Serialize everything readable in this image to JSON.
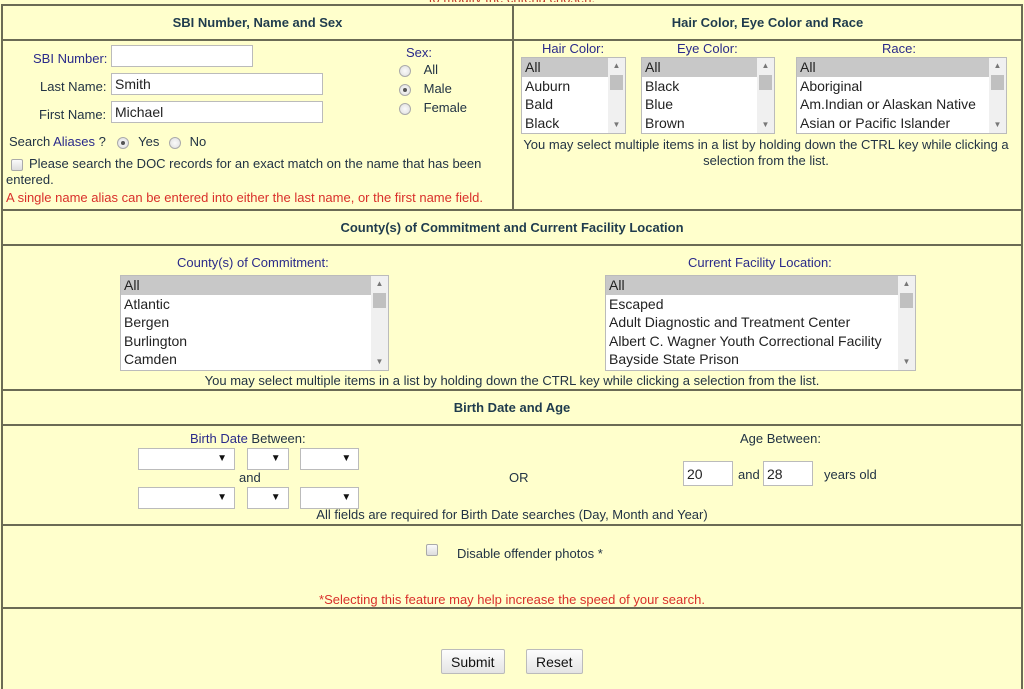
{
  "top_note": "to modify the criteria chosen.",
  "sections": {
    "name_sex": {
      "header": "SBI Number, Name and Sex",
      "sbi_label": "SBI Number:",
      "sbi_value": "",
      "last_name_label": "Last Name:",
      "last_name_value": "Smith",
      "first_name_label": "First Name:",
      "first_name_value": "Michael",
      "sex_label": "Sex:",
      "sex_options": [
        {
          "label": "All",
          "checked": false
        },
        {
          "label": "Male",
          "checked": true
        },
        {
          "label": "Female",
          "checked": false
        }
      ],
      "aliases_prefix": "Search ",
      "aliases_link": "Aliases",
      "aliases_suffix": " ?",
      "aliases_yes": "Yes",
      "aliases_no": "No",
      "exact_match_label": "Please search the DOC records for an exact match on the name that has been entered.",
      "exact_match_checked": false,
      "alias_note": "A single name alias can be entered into either the last name, or the first name field."
    },
    "hair_eye_race": {
      "header": "Hair Color, Eye Color and Race",
      "hair_label": "Hair Color:",
      "hair_options": [
        "All",
        "Auburn",
        "Bald",
        "Black"
      ],
      "eye_label": "Eye Color:",
      "eye_options": [
        "All",
        "Black",
        "Blue",
        "Brown"
      ],
      "race_label": "Race:",
      "race_options": [
        "All",
        "Aboriginal",
        "Am.Indian or Alaskan Native",
        "Asian or Pacific Islander"
      ],
      "note": "You may select multiple items in a list by holding down the CTRL key while clicking a selection from the list."
    },
    "county_facility": {
      "header": "County(s) of Commitment and Current Facility Location",
      "county_label": "County(s) of Commitment:",
      "county_options": [
        "All",
        "Atlantic",
        "Bergen",
        "Burlington",
        "Camden"
      ],
      "facility_label": "Current Facility Location:",
      "facility_options": [
        "All",
        "Escaped",
        "Adult Diagnostic and Treatment Center",
        "Albert C. Wagner Youth Correctional Facility",
        "Bayside State Prison"
      ],
      "note": "You may select multiple items in a list by holding down the CTRL key while clicking a selection from the list."
    },
    "birth_age": {
      "header": "Birth Date and Age",
      "birth_label_link": "Birth Date",
      "birth_label_rest": " Between:",
      "and_label": "and",
      "or_label": "OR",
      "age_label": "Age Between:",
      "age_from": "20",
      "age_and": "and",
      "age_to": "28",
      "age_suffix": "years old",
      "required_note": "All fields are required for Birth Date searches (Day, Month and Year)"
    },
    "photos": {
      "label": "Disable offender photos *",
      "checked": false,
      "note": "*Selecting this feature may help increase the speed of your search."
    }
  },
  "buttons": {
    "submit": "Submit",
    "reset": "Reset"
  }
}
